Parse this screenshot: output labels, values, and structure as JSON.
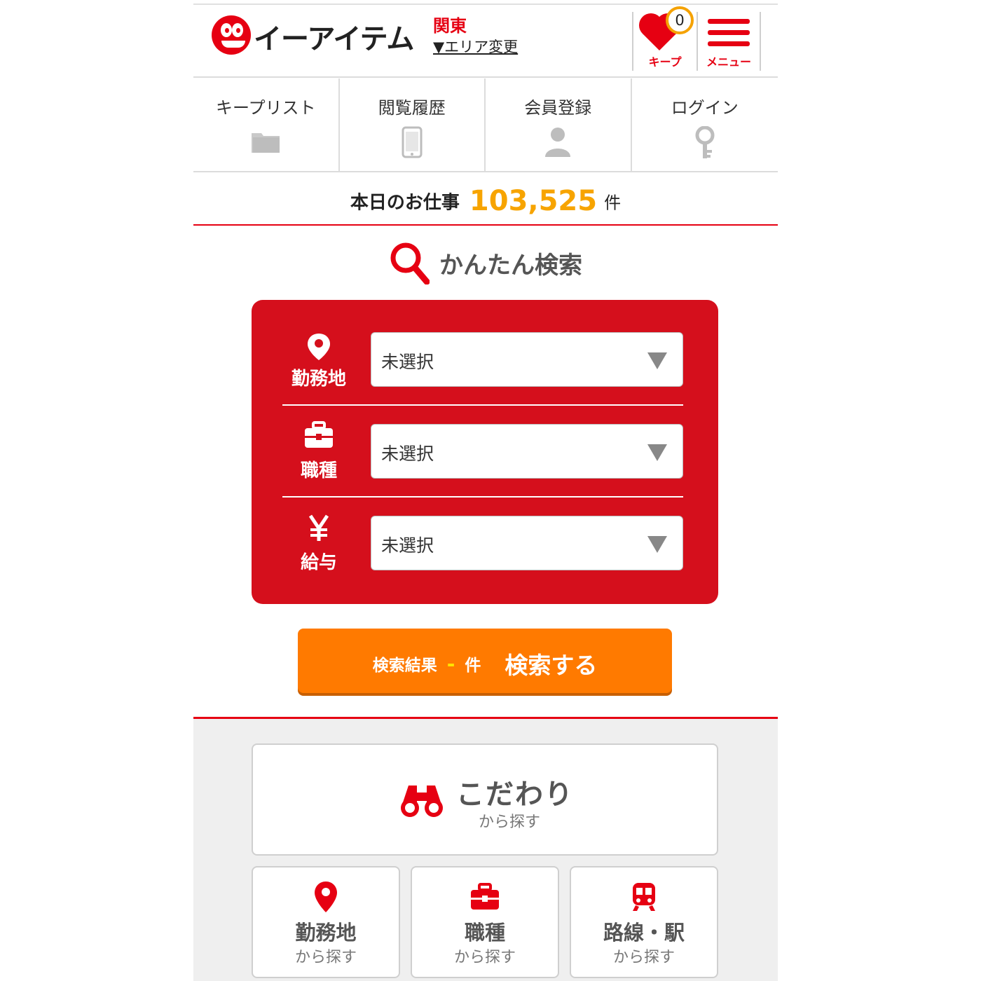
{
  "header": {
    "logo_text": "イーアイテム",
    "area_name": "関東",
    "area_change": "▼エリア変更",
    "keep": {
      "count": "0",
      "label": "キープ"
    },
    "menu_label": "メニュー"
  },
  "quicknav": {
    "items": [
      {
        "label": "キープリスト",
        "icon": "folder-icon"
      },
      {
        "label": "閲覧履歴",
        "icon": "smartphone-icon"
      },
      {
        "label": "会員登録",
        "icon": "person-icon"
      },
      {
        "label": "ログイン",
        "icon": "key-icon"
      }
    ]
  },
  "today": {
    "label": "本日のお仕事",
    "count": "103,525",
    "unit": "件"
  },
  "search": {
    "title": "かんたん検索",
    "rows": [
      {
        "label": "勤務地",
        "icon": "map-pin-icon",
        "value": "未選択"
      },
      {
        "label": "職種",
        "icon": "briefcase-icon",
        "value": "未選択"
      },
      {
        "label": "給与",
        "icon": "yen-icon",
        "value": "未選択"
      }
    ],
    "button": {
      "result_label": "検索結果",
      "result_count": "-",
      "result_unit": "件",
      "action": "検索する"
    }
  },
  "browse": {
    "kodawari": {
      "main": "こだわり",
      "sub": "から探す",
      "icon": "binoculars-icon"
    },
    "tiles": [
      {
        "main": "勤務地",
        "sub": "から探す",
        "icon": "map-pin-icon"
      },
      {
        "main": "職種",
        "sub": "から探す",
        "icon": "briefcase-icon"
      },
      {
        "main": "路線・駅",
        "sub": "から探す",
        "icon": "train-icon"
      }
    ]
  },
  "colors": {
    "brand_red": "#e60012",
    "panel_red": "#d50f1c",
    "accent_orange": "#ff7a00",
    "count_yellow": "#f7a400"
  }
}
